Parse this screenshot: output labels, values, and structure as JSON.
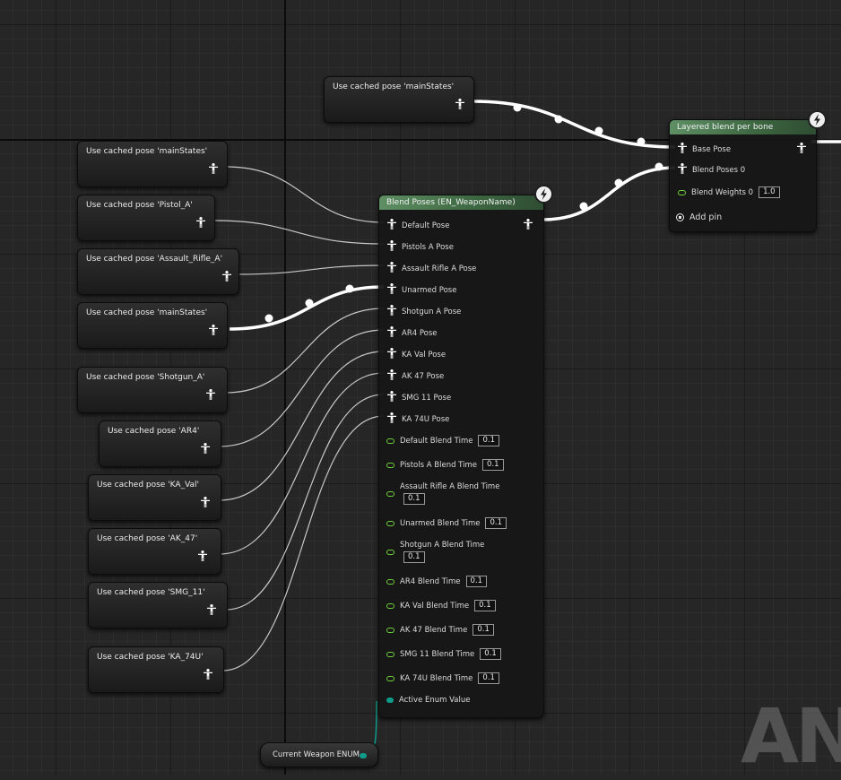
{
  "cached_pose_nodes": [
    {
      "title": "Use cached pose 'mainStates'"
    },
    {
      "title": "Use cached pose 'mainStates'"
    },
    {
      "title": "Use cached pose 'Pistol_A'"
    },
    {
      "title": "Use cached pose 'Assault_Rifle_A'"
    },
    {
      "title": "Use cached pose 'mainStates'"
    },
    {
      "title": "Use cached pose 'Shotgun_A'"
    },
    {
      "title": "Use cached pose 'AR4'"
    },
    {
      "title": "Use cached pose 'KA_Val'"
    },
    {
      "title": "Use cached pose 'AK_47'"
    },
    {
      "title": "Use cached pose 'SMG_11'"
    },
    {
      "title": "Use cached pose 'KA_74U'"
    }
  ],
  "layered_blend": {
    "title": "Layered blend per bone",
    "base_pose": "Base Pose",
    "blend_poses": "Blend Poses 0",
    "blend_weights_label": "Blend Weights 0",
    "blend_weights_value": "1.0",
    "add_pin": "Add pin"
  },
  "blend_poses": {
    "title": "Blend Poses (EN_WeaponName)",
    "pose_pins": [
      "Default Pose",
      "Pistols A Pose",
      "Assault Rifle A Pose",
      "Unarmed Pose",
      "Shotgun A Pose",
      "AR4 Pose",
      "KA Val Pose",
      "AK 47 Pose",
      "SMG 11 Pose",
      "KA 74U Pose"
    ],
    "blend_times": [
      {
        "label": "Default Blend Time",
        "value": "0.1"
      },
      {
        "label": "Pistols A Blend Time",
        "value": "0.1"
      },
      {
        "label": "Assault Rifle A Blend Time",
        "value": "0.1"
      },
      {
        "label": "Unarmed Blend Time",
        "value": "0.1"
      },
      {
        "label": "Shotgun A Blend Time",
        "value": "0.1"
      },
      {
        "label": "AR4 Blend Time",
        "value": "0.1"
      },
      {
        "label": "KA Val Blend Time",
        "value": "0.1"
      },
      {
        "label": "AK 47 Blend Time",
        "value": "0.1"
      },
      {
        "label": "SMG 11 Blend Time",
        "value": "0.1"
      },
      {
        "label": "KA 74U Blend Time",
        "value": "0.1"
      }
    ],
    "active_enum": "Active Enum Value"
  },
  "variable_node": {
    "label": "Current Weapon ENUM"
  },
  "watermark": "AN",
  "colors": {
    "float_pin": "#6fcf3a",
    "enum_pin": "#0f9a8a",
    "header": "#4a7a4e",
    "exec_wire": "#ffffff"
  },
  "icons": [
    "pose-pin-icon",
    "lightning-icon",
    "float-pin-icon",
    "enum-pin-icon",
    "add-pin-icon"
  ]
}
